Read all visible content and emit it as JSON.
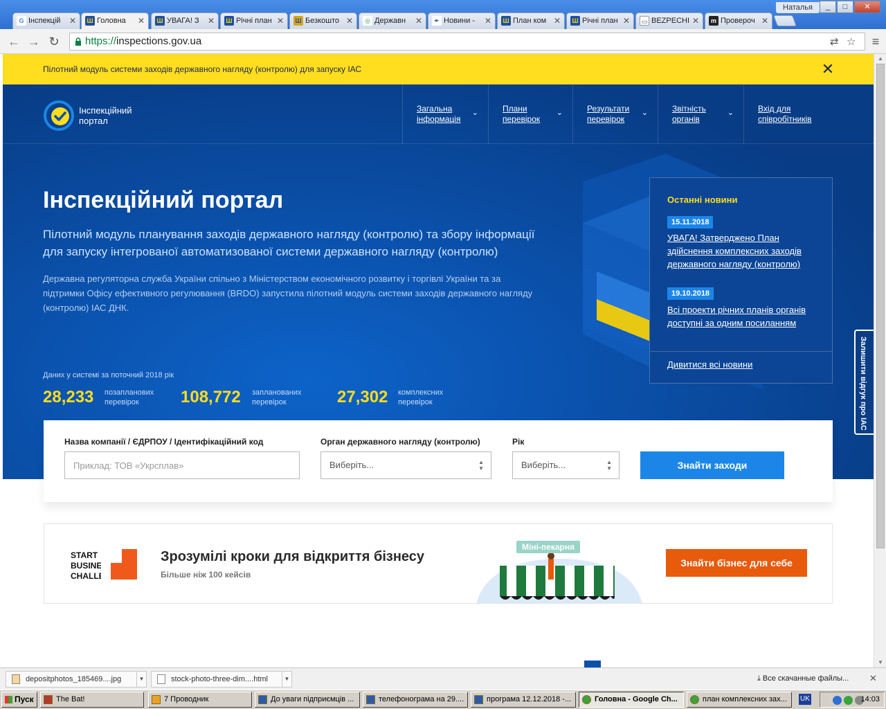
{
  "window": {
    "user": "Наталья",
    "tabs": [
      {
        "label": "Інспекцій"
      },
      {
        "label": "Головна"
      },
      {
        "label": "УВАГА! З"
      },
      {
        "label": "Річні план"
      },
      {
        "label": "Безкошто"
      },
      {
        "label": "Державн"
      },
      {
        "label": "Новини -"
      },
      {
        "label": "План ком"
      },
      {
        "label": "Річні план"
      },
      {
        "label": "BEZPECHI"
      },
      {
        "label": "Провероч"
      }
    ]
  },
  "address_bar": {
    "scheme": "https://",
    "host": "inspections.gov.ua"
  },
  "notice": {
    "text": "Пілотний модуль системи заходів державного нагляду (контролю) для запуску ІАС"
  },
  "header": {
    "logo_line1": "Інспекційний",
    "logo_line2": "портал",
    "nav": [
      {
        "line1": "Загальна",
        "line2": "інформація"
      },
      {
        "line1": "Плани",
        "line2": "перевірок"
      },
      {
        "line1": "Результати",
        "line2": "перевірок"
      },
      {
        "line1": "Звітність",
        "line2": "органів"
      },
      {
        "line1": "Вхід для",
        "line2": "співробітників"
      }
    ]
  },
  "hero": {
    "title": "Інспекційний портал",
    "subtitle": "Пілотний модуль планування заходів державного нагляду (контролю) та збору інформації для запуску інтегрованої автоматизованої системи державного нагляду (контролю)",
    "description": "Державна регуляторна служба України спільно з Міністерством економічного розвитку і торгівлі України та за підтримки Офісу ефективного регулювання (BRDO) запустила пілотний модуль системи заходів державного нагляду (контролю) ІАС ДНК.",
    "stats_caption": "Даних у системі за поточний 2018 рік",
    "stats": [
      {
        "value": "28,233",
        "line1": "позапланових",
        "line2": "перевірок"
      },
      {
        "value": "108,772",
        "line1": "запланованих",
        "line2": "перевірок"
      },
      {
        "value": "27,302",
        "line1": "комплексних",
        "line2": "перевірок"
      }
    ]
  },
  "news": {
    "title": "Останні новини",
    "items": [
      {
        "date": "15.11.2018",
        "text": "УВАГА! Затверджено План здійснення комплексних заходів державного нагляду (контролю)"
      },
      {
        "date": "19.10.2018",
        "text": "Всі проекти річних планів органів доступні за одним посиланням"
      }
    ],
    "all_link": "Дивитися всі новини"
  },
  "feedback_tab": "Залишити відгук про ІАС",
  "search": {
    "company_label": "Назва компанії / ЄДРПОУ / Ідентифікаційний код",
    "company_placeholder": "Приклад: ТОВ «Укрсплав»",
    "authority_label": "Орган державного нагляду (контролю)",
    "authority_value": "Виберіть...",
    "year_label": "Рік",
    "year_value": "Виберіть...",
    "submit": "Знайти заходи"
  },
  "promo": {
    "logo_line1": "START",
    "logo_line2": "BUSINESS",
    "logo_line3": "CHALLENGE",
    "title": "Зрозумілі кроки для відкриття бізнесу",
    "subtitle": "Більше ніж 100 кейсів",
    "sign": "Міні-пекарня",
    "button": "Знайти бізнес для себе"
  },
  "downloads": {
    "items": [
      {
        "name": "depositphotos_185469....jpg"
      },
      {
        "name": "stock-photo-three-dim....html"
      }
    ],
    "show_all": "Все скачанные файлы..."
  },
  "taskbar": {
    "start": "Пуск",
    "tasks": [
      {
        "label": "The Bat!"
      },
      {
        "label": "7 Проводник"
      },
      {
        "label": "До уваги підприємців ..."
      },
      {
        "label": "телефонограма на 29...."
      },
      {
        "label": "програма 12.12.2018 -..."
      },
      {
        "label": "Головна - Google Ch..."
      },
      {
        "label": "план комплексних зах..."
      }
    ],
    "lang": "UK",
    "time": "14:03"
  },
  "colors": {
    "notice_bg": "#ffdd1f",
    "hero_bg": "#0a4fa8",
    "accent_yellow": "#ffdd1f",
    "primary_button": "#1c86e8",
    "promo_button": "#e85a0c"
  }
}
